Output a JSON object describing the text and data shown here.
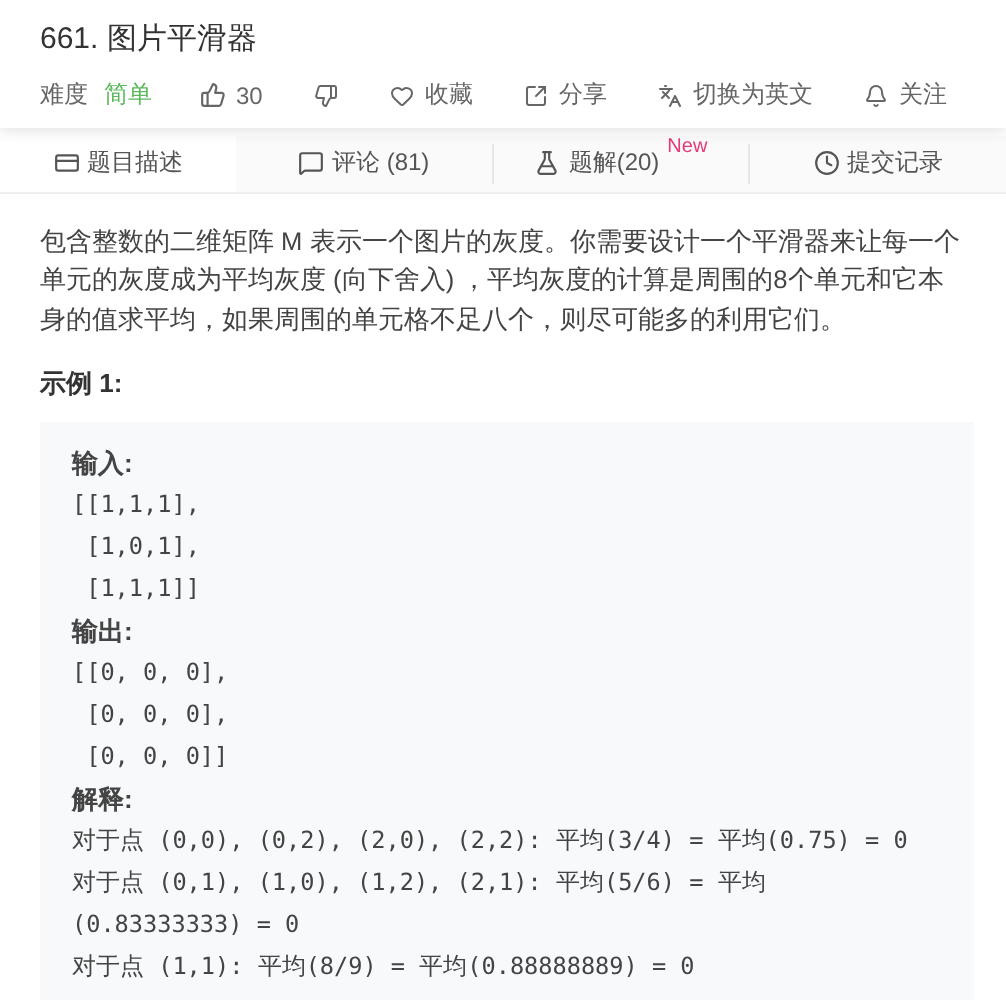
{
  "title": "661. 图片平滑器",
  "meta": {
    "difficulty_label": "难度",
    "difficulty": "简单",
    "likes": "30"
  },
  "actions": [
    {
      "kind": "dislike"
    },
    {
      "kind": "favorite",
      "label": "收藏"
    },
    {
      "kind": "share",
      "label": "分享"
    },
    {
      "kind": "translate",
      "label": "切换为英文"
    },
    {
      "kind": "follow",
      "label": "关注"
    }
  ],
  "tabs": [
    {
      "kind": "description",
      "label": "题目描述",
      "selected": true
    },
    {
      "kind": "comments",
      "label": "评论 (81)",
      "selected": false
    },
    {
      "kind": "solutions",
      "label": "题解(20)",
      "badge": "New",
      "selected": false
    },
    {
      "kind": "submissions",
      "label": "提交记录",
      "selected": false
    }
  ],
  "description": "包含整数的二维矩阵 M 表示一个图片的灰度。你需要设计一个平滑器来让每一个单元的灰度成为平均灰度 (向下舍入) ，平均灰度的计算是周围的8个单元和它本身的值求平均，如果周围的单元格不足八个，则尽可能多的利用它们。",
  "example_title": "示例 1:",
  "example_lines": [
    {
      "kind": "label",
      "text": "输入:"
    },
    {
      "kind": "code",
      "text": "[[1,1,1],"
    },
    {
      "kind": "code",
      "text": " [1,0,1],"
    },
    {
      "kind": "code",
      "text": " [1,1,1]]"
    },
    {
      "kind": "label",
      "text": "输出:"
    },
    {
      "kind": "code",
      "text": "[[0, 0, 0],"
    },
    {
      "kind": "code",
      "text": " [0, 0, 0],"
    },
    {
      "kind": "code",
      "text": " [0, 0, 0]]"
    },
    {
      "kind": "label",
      "text": "解释:"
    },
    {
      "kind": "code",
      "text": "对于点 (0,0), (0,2), (2,0), (2,2): 平均(3/4) = 平均(0.75) = 0"
    },
    {
      "kind": "code",
      "text": "对于点 (0,1), (1,0), (1,2), (2,1): 平均(5/6) = 平均"
    },
    {
      "kind": "code",
      "text": "(0.83333333) = 0"
    },
    {
      "kind": "code",
      "text": "对于点 (1,1): 平均(8/9) = 平均(0.88888889) = 0"
    }
  ]
}
